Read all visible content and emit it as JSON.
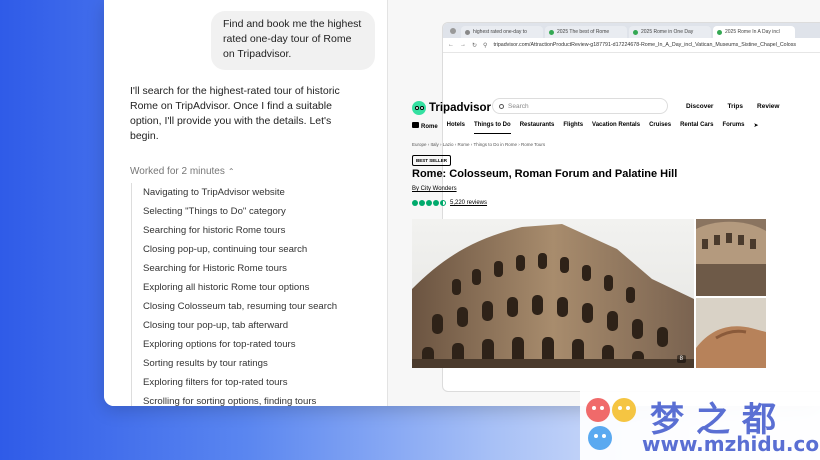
{
  "chat": {
    "user_message": "Find and book me the highest rated one-day tour of Rome on Tripadvisor.",
    "assistant_message": "I'll search for the highest-rated tour of historic Rome on TripAdvisor. Once I find a suitable option, I'll provide you with the details. Let's begin.",
    "worked_label": "Worked for 2 minutes",
    "steps": [
      "Navigating to TripAdvisor website",
      "Selecting \"Things to Do\" category",
      "Searching for historic Rome tours",
      "Closing pop-up, continuing tour search",
      "Searching for Historic Rome tours",
      "Exploring all historic Rome tour options",
      "Closing Colosseum tab, resuming tour search",
      "Closing tour pop-up, tab afterward",
      "Exploring options for top-rated tours",
      "Sorting results by tour ratings",
      "Exploring filters for top-rated tours",
      "Scrolling for sorting options, finding tours"
    ]
  },
  "browser": {
    "tabs": [
      {
        "label": "highest rated one-day to",
        "active": false
      },
      {
        "label": "2025 The best of Rome",
        "active": false
      },
      {
        "label": "2025 Rome in One Day",
        "active": false
      },
      {
        "label": "2025 Rome In A Day incl",
        "active": true
      }
    ],
    "url": "tripadvisor.com/AttractionProductReview-g187791-d17224678-Rome_In_A_Day_incl_Vatican_Museums_Sistine_Chapel_Coloss"
  },
  "tripadvisor": {
    "logo_text": "Tripadvisor",
    "search_placeholder": "Search",
    "top_links": [
      "Discover",
      "Trips",
      "Review"
    ],
    "nav": [
      {
        "label": "Rome",
        "active": false
      },
      {
        "label": "Hotels",
        "active": false
      },
      {
        "label": "Things to Do",
        "active": true
      },
      {
        "label": "Restaurants",
        "active": false
      },
      {
        "label": "Flights",
        "active": false
      },
      {
        "label": "Vacation Rentals",
        "active": false
      },
      {
        "label": "Cruises",
        "active": false
      },
      {
        "label": "Rental Cars",
        "active": false
      },
      {
        "label": "Forums",
        "active": false
      }
    ],
    "breadcrumb": "Europe  ›  Italy  ›  Lazio  ›  Rome  ›  Things to Do in Rome  ›  Rome Tours",
    "badge": "BEST SELLER",
    "title": "Rome: Colosseum, Roman Forum and Palatine Hill",
    "byline": "By City Wonders",
    "rating": 4.5,
    "reviews": "5,220 reviews",
    "photo_count": "8"
  },
  "watermark": {
    "text": "梦之都",
    "url": "www.mzhidu.com"
  },
  "colors": {
    "tripadvisor_green": "#34e0a1",
    "rating_green": "#00aa6c",
    "watermark_blue": "#5a6fd3"
  }
}
